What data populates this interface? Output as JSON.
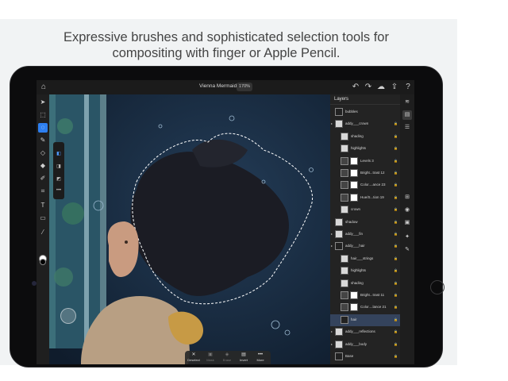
{
  "headline": {
    "line1": "Expressive brushes and sophisticated selection tools for",
    "line2": "compositing with finger or Apple Pencil."
  },
  "app": {
    "doc_title": "Vienna Mermaid *",
    "zoom": "170%",
    "topbar_icons": [
      "home-icon",
      "undo-icon",
      "redo-icon",
      "cloud-icon",
      "share-icon",
      "help-icon"
    ],
    "toolbar_tools": [
      "move",
      "select",
      "lasso",
      "brush",
      "eraser",
      "fill",
      "healing",
      "crop",
      "text",
      "image",
      "eyedropper"
    ],
    "subtools": [
      "add-selection",
      "subtract-selection",
      "intersect-selection",
      "overflow"
    ],
    "action_bar": [
      {
        "glyph": "✕",
        "label": "Deselect"
      },
      {
        "glyph": "▣",
        "label": "Mask"
      },
      {
        "glyph": "◈",
        "label": "Erase"
      },
      {
        "glyph": "▤",
        "label": "Invert"
      },
      {
        "glyph": "•••",
        "label": "More"
      }
    ]
  },
  "layers_panel": {
    "title": "Layers",
    "layers": [
      {
        "name": "bubbles",
        "indent": 0,
        "thumb": "dark",
        "mask": false,
        "group": false,
        "selected": false
      },
      {
        "name": "addy___crown",
        "indent": 0,
        "thumb": "light",
        "mask": false,
        "group": true,
        "selected": false
      },
      {
        "name": "shading",
        "indent": 1,
        "thumb": "light",
        "mask": false,
        "group": false,
        "selected": false
      },
      {
        "name": "highlights",
        "indent": 1,
        "thumb": "light",
        "mask": false,
        "group": false,
        "selected": false
      },
      {
        "name": "Levels 3",
        "indent": 1,
        "thumb": "adj",
        "mask": true,
        "group": false,
        "selected": false
      },
      {
        "name": "Bright...trast 12",
        "indent": 1,
        "thumb": "adj",
        "mask": true,
        "group": false,
        "selected": false
      },
      {
        "name": "Color....ance 23",
        "indent": 1,
        "thumb": "adj",
        "mask": true,
        "group": false,
        "selected": false
      },
      {
        "name": "Hue/S...tion 19",
        "indent": 1,
        "thumb": "adj",
        "mask": true,
        "group": false,
        "selected": false
      },
      {
        "name": "crown",
        "indent": 1,
        "thumb": "light",
        "mask": false,
        "group": false,
        "selected": false
      },
      {
        "name": "shadow",
        "indent": 0,
        "thumb": "light",
        "mask": false,
        "group": false,
        "selected": false
      },
      {
        "name": "addy___fin",
        "indent": 0,
        "thumb": "light",
        "mask": false,
        "group": true,
        "selected": false
      },
      {
        "name": "addy___hair",
        "indent": 0,
        "thumb": "dark",
        "mask": false,
        "group": true,
        "selected": false
      },
      {
        "name": "hair___strings",
        "indent": 1,
        "thumb": "light",
        "mask": false,
        "group": false,
        "selected": false
      },
      {
        "name": "highlights",
        "indent": 1,
        "thumb": "light",
        "mask": false,
        "group": false,
        "selected": false
      },
      {
        "name": "shading",
        "indent": 1,
        "thumb": "light",
        "mask": false,
        "group": false,
        "selected": false
      },
      {
        "name": "Bright...trast 11",
        "indent": 1,
        "thumb": "adj",
        "mask": true,
        "group": false,
        "selected": false
      },
      {
        "name": "Color....lance 21",
        "indent": 1,
        "thumb": "adj",
        "mask": true,
        "group": false,
        "selected": false
      },
      {
        "name": "hair",
        "indent": 1,
        "thumb": "dark",
        "mask": false,
        "group": false,
        "selected": true
      },
      {
        "name": "addy___reflections",
        "indent": 0,
        "thumb": "light",
        "mask": false,
        "group": true,
        "selected": false
      },
      {
        "name": "addy___body",
        "indent": 0,
        "thumb": "light",
        "mask": false,
        "group": true,
        "selected": false
      },
      {
        "name": "Base",
        "indent": 0,
        "thumb": "dark",
        "mask": false,
        "group": false,
        "selected": false
      }
    ]
  },
  "right_toolbar": [
    "layers-icon",
    "layer-properties-icon",
    "adjustments-icon",
    "add-layer-icon",
    "visibility-icon",
    "mask-icon",
    "fx-icon",
    "brush-mask-icon"
  ],
  "colors": {
    "selection_highlight": "#2d7ff0",
    "selected_layer": "#34435c",
    "panel_bg": "#232323"
  }
}
